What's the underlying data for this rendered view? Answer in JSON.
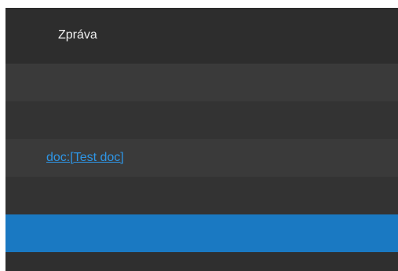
{
  "table": {
    "header": {
      "column_label": "Zpráva"
    },
    "rows": [
      {
        "text": "",
        "selected": false
      },
      {
        "text": "",
        "selected": false
      },
      {
        "text": "doc:[Test doc]",
        "is_link": true,
        "selected": false
      },
      {
        "text": "",
        "selected": false
      },
      {
        "text": "",
        "selected": true
      },
      {
        "text": "",
        "selected": false
      }
    ]
  },
  "colors": {
    "background": "#2f2f2f",
    "row_alt": "#3a3a3a",
    "selected_row": "#1a79c2",
    "link": "#2e96e6",
    "header_text": "#f0f0f0"
  }
}
